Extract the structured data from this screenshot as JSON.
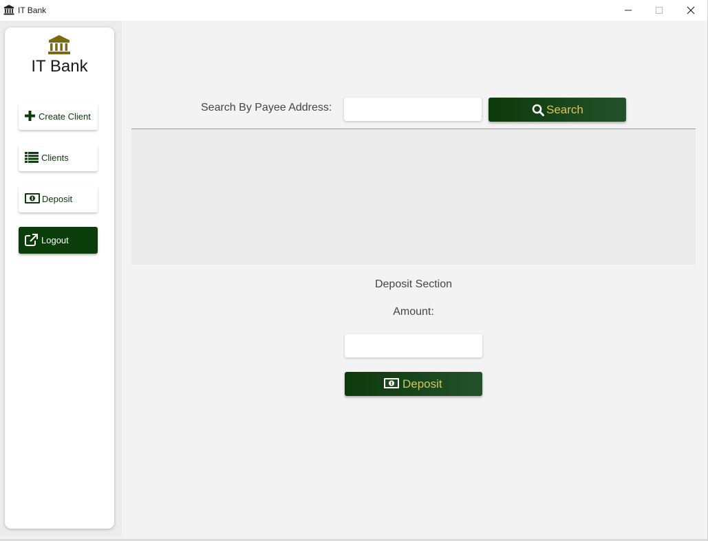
{
  "window": {
    "title": "IT Bank",
    "icon": "bank-icon",
    "controls": [
      "minimize-icon",
      "maximize-icon",
      "close-icon"
    ]
  },
  "sidebar": {
    "brand_icon": "bank-icon",
    "brand_title": "IT Bank",
    "items": [
      {
        "label": "Create Client",
        "icon": "plus-icon"
      },
      {
        "label": "Clients",
        "icon": "list-icon"
      },
      {
        "label": "Deposit",
        "icon": "money-icon"
      },
      {
        "label": "Logout",
        "icon": "external-link-icon"
      }
    ]
  },
  "search": {
    "label": "Search By Payee Address:",
    "value": "",
    "placeholder": "",
    "button_label": "Search",
    "button_icon": "search-icon"
  },
  "deposit_section": {
    "title": "Deposit Section",
    "amount_label": "Amount:",
    "amount_value": "",
    "button_label": "Deposit",
    "button_icon": "money-icon"
  },
  "colors": {
    "primary_green": "#0a3d0a",
    "accent_gold": "#d8c55a",
    "brand_gold": "#7a6a10"
  }
}
